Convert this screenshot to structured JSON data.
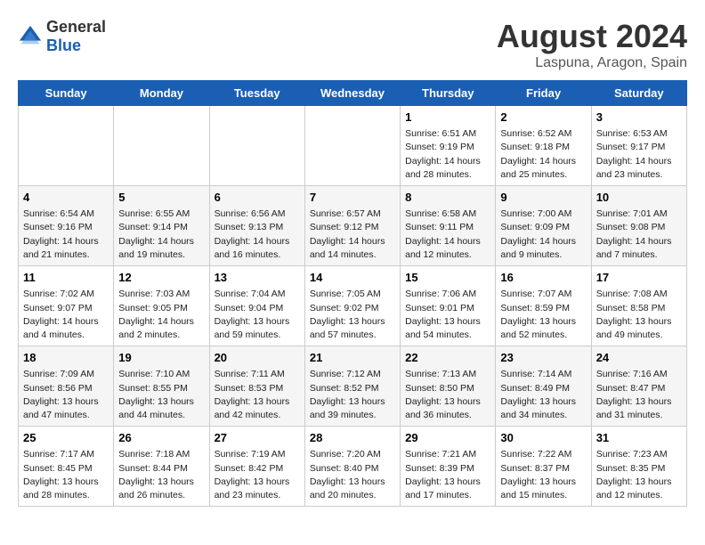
{
  "header": {
    "logo_general": "General",
    "logo_blue": "Blue",
    "month_year": "August 2024",
    "location": "Laspuna, Aragon, Spain"
  },
  "weekdays": [
    "Sunday",
    "Monday",
    "Tuesday",
    "Wednesday",
    "Thursday",
    "Friday",
    "Saturday"
  ],
  "weeks": [
    [
      {
        "day": "",
        "info": ""
      },
      {
        "day": "",
        "info": ""
      },
      {
        "day": "",
        "info": ""
      },
      {
        "day": "",
        "info": ""
      },
      {
        "day": "1",
        "info": "Sunrise: 6:51 AM\nSunset: 9:19 PM\nDaylight: 14 hours\nand 28 minutes."
      },
      {
        "day": "2",
        "info": "Sunrise: 6:52 AM\nSunset: 9:18 PM\nDaylight: 14 hours\nand 25 minutes."
      },
      {
        "day": "3",
        "info": "Sunrise: 6:53 AM\nSunset: 9:17 PM\nDaylight: 14 hours\nand 23 minutes."
      }
    ],
    [
      {
        "day": "4",
        "info": "Sunrise: 6:54 AM\nSunset: 9:16 PM\nDaylight: 14 hours\nand 21 minutes."
      },
      {
        "day": "5",
        "info": "Sunrise: 6:55 AM\nSunset: 9:14 PM\nDaylight: 14 hours\nand 19 minutes."
      },
      {
        "day": "6",
        "info": "Sunrise: 6:56 AM\nSunset: 9:13 PM\nDaylight: 14 hours\nand 16 minutes."
      },
      {
        "day": "7",
        "info": "Sunrise: 6:57 AM\nSunset: 9:12 PM\nDaylight: 14 hours\nand 14 minutes."
      },
      {
        "day": "8",
        "info": "Sunrise: 6:58 AM\nSunset: 9:11 PM\nDaylight: 14 hours\nand 12 minutes."
      },
      {
        "day": "9",
        "info": "Sunrise: 7:00 AM\nSunset: 9:09 PM\nDaylight: 14 hours\nand 9 minutes."
      },
      {
        "day": "10",
        "info": "Sunrise: 7:01 AM\nSunset: 9:08 PM\nDaylight: 14 hours\nand 7 minutes."
      }
    ],
    [
      {
        "day": "11",
        "info": "Sunrise: 7:02 AM\nSunset: 9:07 PM\nDaylight: 14 hours\nand 4 minutes."
      },
      {
        "day": "12",
        "info": "Sunrise: 7:03 AM\nSunset: 9:05 PM\nDaylight: 14 hours\nand 2 minutes."
      },
      {
        "day": "13",
        "info": "Sunrise: 7:04 AM\nSunset: 9:04 PM\nDaylight: 13 hours\nand 59 minutes."
      },
      {
        "day": "14",
        "info": "Sunrise: 7:05 AM\nSunset: 9:02 PM\nDaylight: 13 hours\nand 57 minutes."
      },
      {
        "day": "15",
        "info": "Sunrise: 7:06 AM\nSunset: 9:01 PM\nDaylight: 13 hours\nand 54 minutes."
      },
      {
        "day": "16",
        "info": "Sunrise: 7:07 AM\nSunset: 8:59 PM\nDaylight: 13 hours\nand 52 minutes."
      },
      {
        "day": "17",
        "info": "Sunrise: 7:08 AM\nSunset: 8:58 PM\nDaylight: 13 hours\nand 49 minutes."
      }
    ],
    [
      {
        "day": "18",
        "info": "Sunrise: 7:09 AM\nSunset: 8:56 PM\nDaylight: 13 hours\nand 47 minutes."
      },
      {
        "day": "19",
        "info": "Sunrise: 7:10 AM\nSunset: 8:55 PM\nDaylight: 13 hours\nand 44 minutes."
      },
      {
        "day": "20",
        "info": "Sunrise: 7:11 AM\nSunset: 8:53 PM\nDaylight: 13 hours\nand 42 minutes."
      },
      {
        "day": "21",
        "info": "Sunrise: 7:12 AM\nSunset: 8:52 PM\nDaylight: 13 hours\nand 39 minutes."
      },
      {
        "day": "22",
        "info": "Sunrise: 7:13 AM\nSunset: 8:50 PM\nDaylight: 13 hours\nand 36 minutes."
      },
      {
        "day": "23",
        "info": "Sunrise: 7:14 AM\nSunset: 8:49 PM\nDaylight: 13 hours\nand 34 minutes."
      },
      {
        "day": "24",
        "info": "Sunrise: 7:16 AM\nSunset: 8:47 PM\nDaylight: 13 hours\nand 31 minutes."
      }
    ],
    [
      {
        "day": "25",
        "info": "Sunrise: 7:17 AM\nSunset: 8:45 PM\nDaylight: 13 hours\nand 28 minutes."
      },
      {
        "day": "26",
        "info": "Sunrise: 7:18 AM\nSunset: 8:44 PM\nDaylight: 13 hours\nand 26 minutes."
      },
      {
        "day": "27",
        "info": "Sunrise: 7:19 AM\nSunset: 8:42 PM\nDaylight: 13 hours\nand 23 minutes."
      },
      {
        "day": "28",
        "info": "Sunrise: 7:20 AM\nSunset: 8:40 PM\nDaylight: 13 hours\nand 20 minutes."
      },
      {
        "day": "29",
        "info": "Sunrise: 7:21 AM\nSunset: 8:39 PM\nDaylight: 13 hours\nand 17 minutes."
      },
      {
        "day": "30",
        "info": "Sunrise: 7:22 AM\nSunset: 8:37 PM\nDaylight: 13 hours\nand 15 minutes."
      },
      {
        "day": "31",
        "info": "Sunrise: 7:23 AM\nSunset: 8:35 PM\nDaylight: 13 hours\nand 12 minutes."
      }
    ]
  ]
}
